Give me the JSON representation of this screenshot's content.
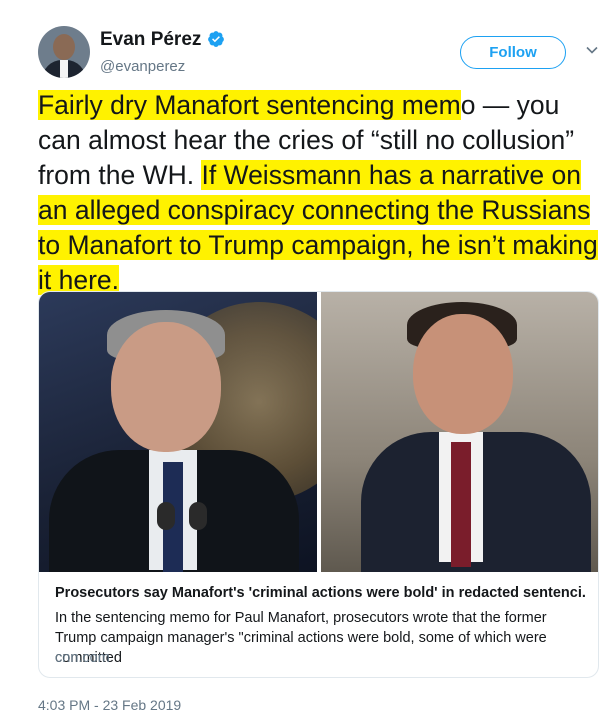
{
  "author": {
    "name": "Evan Pérez",
    "handle": "@evanperez",
    "verified_icon": "verified-badge-icon"
  },
  "actions": {
    "follow_label": "Follow",
    "menu_icon": "chevron-down-icon"
  },
  "tweet": {
    "segments": [
      {
        "text": "Fairly dry Manafort sentencing mem",
        "highlight": true
      },
      {
        "text": "o — you can almost hear the cries of “still no collusion” from the WH. ",
        "highlight": false
      },
      {
        "text": "If Weissmann has a narrative on an alleged conspiracy connecting the Russians to Manafort to Trump campaign, he isn’t making it here.",
        "highlight": true
      }
    ]
  },
  "card": {
    "title": "Prosecutors say Manafort's 'criminal actions were bold' in redacted sentenci...",
    "description": "In the sentencing memo for Paul Manafort, prosecutors wrote that the former Trump campaign manager's \"criminal actions were bold, some of which were committed",
    "domain": "cnn.com"
  },
  "timestamp": "4:03 PM - 23 Feb 2019",
  "colors": {
    "accent": "#1da1f2",
    "highlight": "#fff200",
    "muted": "#657786"
  }
}
